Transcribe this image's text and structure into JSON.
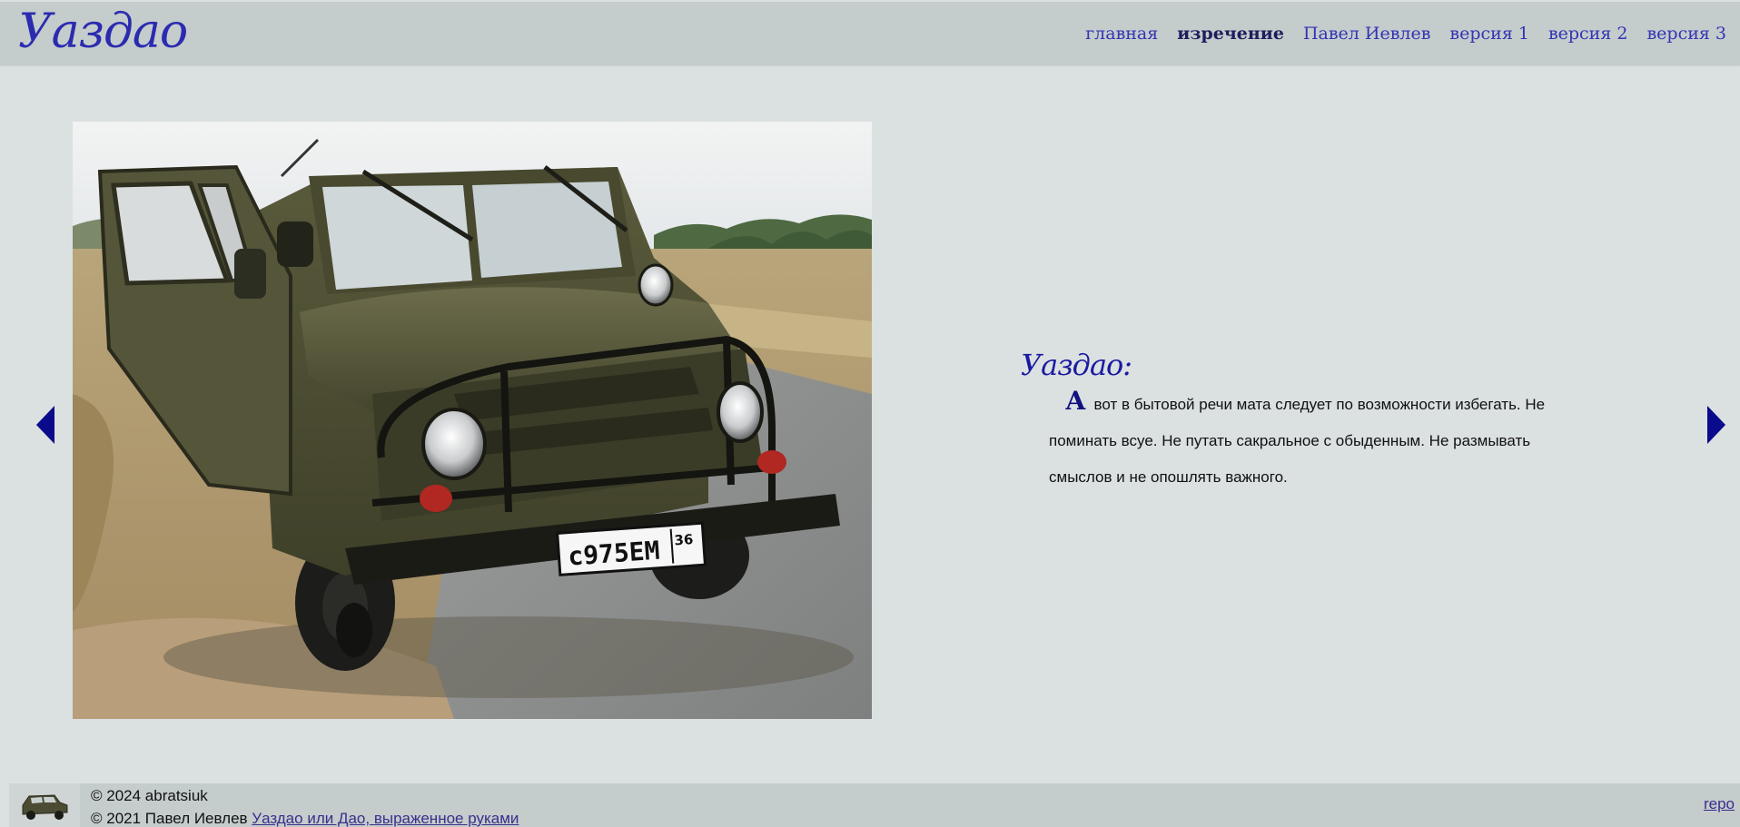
{
  "header": {
    "logo": "Уаздао",
    "nav": [
      {
        "label": "главная",
        "active": false
      },
      {
        "label": "изречение",
        "active": true
      },
      {
        "label": "Павел Иевлев",
        "active": false
      },
      {
        "label": "версия 1",
        "active": false
      },
      {
        "label": "версия 2",
        "active": false
      },
      {
        "label": "версия 3",
        "active": false
      }
    ]
  },
  "main": {
    "photo": {
      "plate_text": "с975ЕМ",
      "plate_region": "36"
    },
    "quote": {
      "author": "Уаздао:",
      "dropcap": "А",
      "text": " вот в бытовой речи мата следует по возможности избегать. Не поминать всуе. Не путать сакральное с обыденным. Не размывать смыслов и не опошлять важного."
    },
    "arrows": {
      "prev_icon": "triangle-left-icon",
      "next_icon": "triangle-right-icon"
    }
  },
  "footer": {
    "line1": "© 2024 abratsiuk",
    "line2_prefix": "© 2021 Павел Иевлев ",
    "line2_link": "Уаздао или Дао, выраженное руками",
    "repo": "repo"
  },
  "colors": {
    "header_bg": "#c4cccc",
    "page_bg": "#dbe0e1",
    "link": "#3434b4",
    "arrow": "#0a0a8c"
  }
}
